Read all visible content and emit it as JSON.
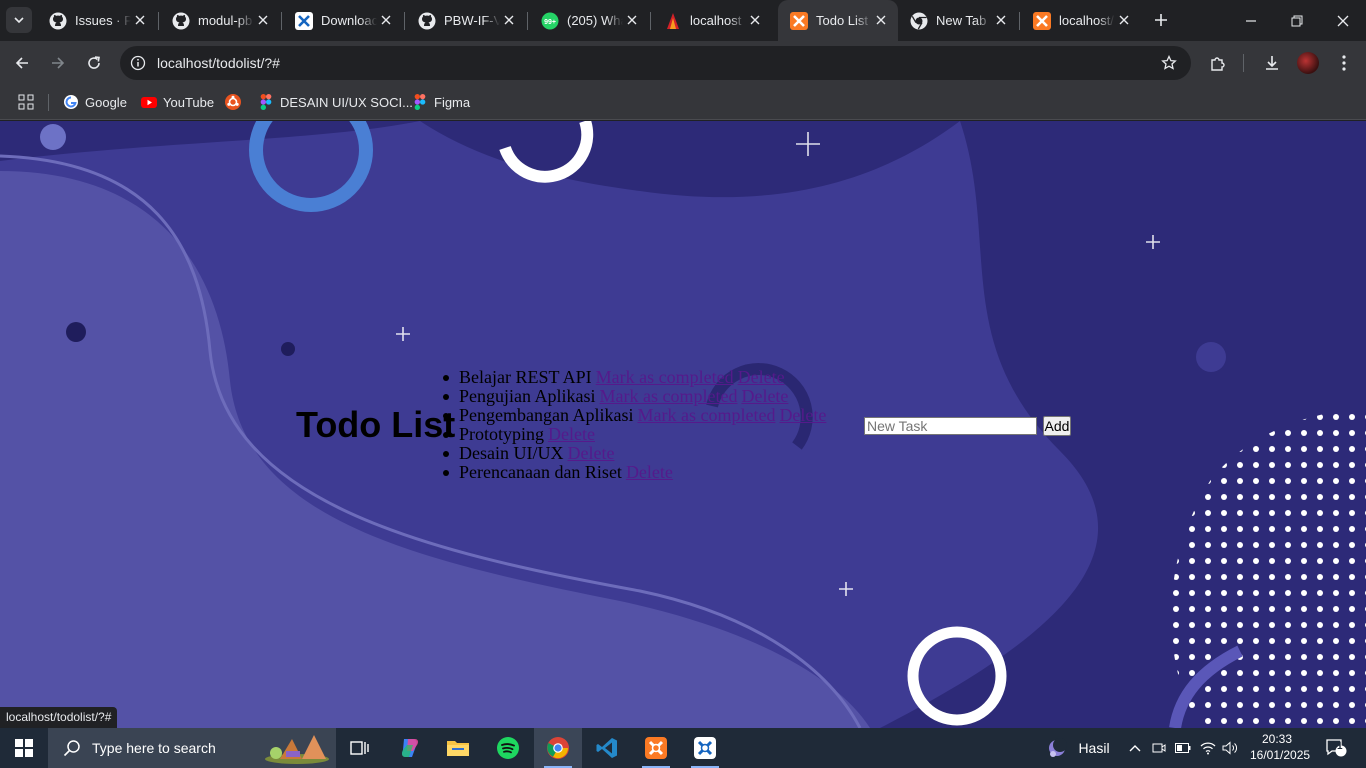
{
  "browser": {
    "tabs": [
      {
        "title": "Issues · Pe",
        "icon": "github-icon",
        "active": false
      },
      {
        "title": "modul-pb",
        "icon": "github-icon",
        "active": false
      },
      {
        "title": "Downloac",
        "icon": "xampp-blue-icon",
        "active": false
      },
      {
        "title": "PBW-IF-V",
        "icon": "github-icon",
        "active": false
      },
      {
        "title": "(205) Wha",
        "icon": "whatsapp-icon",
        "active": false
      },
      {
        "title": "localhost",
        "icon": "apache-icon",
        "active": false
      },
      {
        "title": "Todo List",
        "icon": "xampp-icon",
        "active": true
      },
      {
        "title": "New Tab",
        "icon": "chrome-icon",
        "active": false
      },
      {
        "title": "localhost/",
        "icon": "xampp-icon",
        "active": false
      }
    ],
    "address": "localhost/todolist/?#",
    "bookmarks": [
      {
        "label": "",
        "icon": "apps-grid-icon"
      },
      {
        "label": "Google",
        "icon": "google-icon"
      },
      {
        "label": "YouTube",
        "icon": "youtube-icon"
      },
      {
        "label": "",
        "icon": "ubuntu-icon"
      },
      {
        "label": "DESAIN UI/UX SOCI...",
        "icon": "figma-icon"
      },
      {
        "label": "Figma",
        "icon": "figma-icon"
      }
    ],
    "status_url": "localhost/todolist/?#"
  },
  "page": {
    "title": "Todo List",
    "tasks": [
      {
        "name": "Belajar REST API",
        "links": [
          "Mark as completed",
          "Delete"
        ]
      },
      {
        "name": "Pengujian Aplikasi",
        "links": [
          "Mark as completed",
          "Delete"
        ]
      },
      {
        "name": "Pengembangan Aplikasi",
        "links": [
          "Mark as completed",
          "Delete"
        ]
      },
      {
        "name": "Prototyping",
        "links": [
          "Delete"
        ]
      },
      {
        "name": "Desain UI/UX",
        "links": [
          "Delete"
        ]
      },
      {
        "name": "Perencanaan dan Riset",
        "links": [
          "Delete"
        ]
      }
    ],
    "new_task_placeholder": "New Task",
    "add_label": "Add"
  },
  "taskbar": {
    "search_placeholder": "Type here to search",
    "weather_label": "Hasil",
    "time": "20:33",
    "date": "16/01/2025",
    "notification_count": "1"
  },
  "colors": {
    "page_bg_dark": "#2d2a78",
    "page_bg_mid": "#3e3b93",
    "page_bg_light": "#5452a6",
    "link": "#551a8b",
    "accent_blue": "#4a7fd4"
  }
}
